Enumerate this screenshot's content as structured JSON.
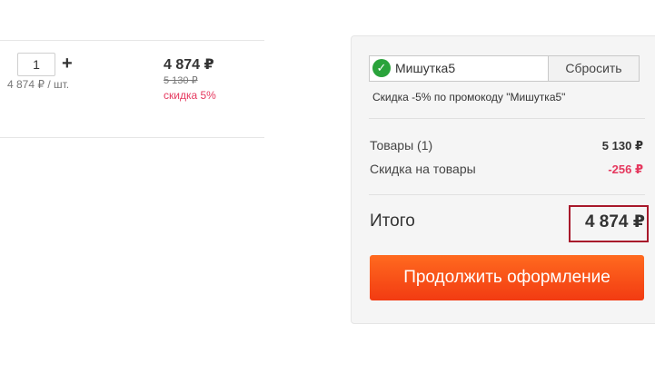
{
  "cart_item": {
    "quantity": "1",
    "plus_label": "+",
    "unit_price": "4 874 ₽ / шт.",
    "price_now": "4 874 ₽",
    "price_old": "5 130 ₽",
    "discount": "скидка 5%"
  },
  "summary": {
    "promo": {
      "check_icon": "checkmark-icon",
      "check_glyph": "✓",
      "code": "Мишутка5",
      "reset_label": "Сбросить",
      "note": "Скидка -5% по промокоду \"Мишутка5\""
    },
    "goods_label": "Товары (1)",
    "goods_value": "5 130 ₽",
    "discount_label": "Скидка на товары",
    "discount_value": "-256 ₽",
    "total_label": "Итого",
    "total_value": "4 874 ₽",
    "checkout_label": "Продолжить оформление"
  },
  "colors": {
    "accent_orange": "#f23b12",
    "discount_red": "#e5385e",
    "success_green": "#2aa33b",
    "highlight_border": "#a8182b"
  }
}
